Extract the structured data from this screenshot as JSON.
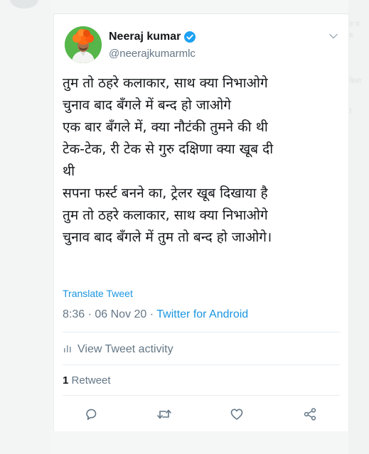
{
  "author": {
    "name": "Neeraj kumar",
    "handle": "@neerajkumarmlc",
    "verified": true
  },
  "tweet": {
    "lines": [
      "तुम तो ठहरे कलाकार, साथ क्या निभाओगे",
      "चुनाव बाद बँगले में बन्द हो जाओगे",
      "एक बार बँगले में, क्या नौटंकी तुमने की थी",
      "टेक-टेक, री टेक से गुरु दक्षिणा क्या खूब दी",
      "थी",
      "सपना फर्स्ट बनने का, ट्रेलर खूब दिखाया है",
      "तुम तो ठहरे कलाकार, साथ क्या निभाओगे",
      "चुनाव बाद बँगले में तुम तो बन्द हो जाओगे।"
    ],
    "translate_label": "Translate Tweet",
    "time": "8:36",
    "date": "06 Nov 20",
    "separator": "·",
    "source": "Twitter for Android"
  },
  "activity": {
    "label": "View Tweet activity"
  },
  "stats": {
    "retweet_count": "1",
    "retweet_label": "Retweet"
  },
  "colors": {
    "link": "#1b95e0",
    "muted": "#657786",
    "text": "#14171a",
    "verified": "#1da1f2"
  },
  "icons": [
    "chevron-down-icon",
    "verified-badge-icon",
    "bar-chart-icon",
    "reply-icon",
    "retweet-icon",
    "like-icon",
    "share-icon"
  ]
}
